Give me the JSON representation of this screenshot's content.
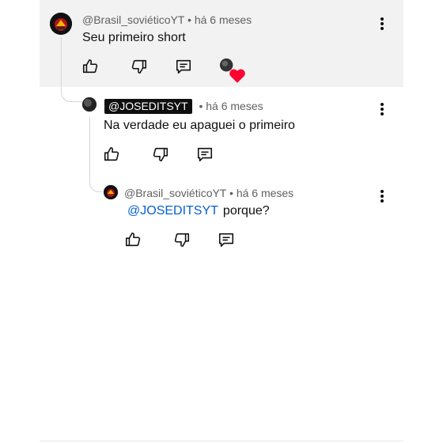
{
  "comments": [
    {
      "author": "@Brasil_soviéticoYT",
      "time": "há 6 meses",
      "text": "Seu primeiro short",
      "icons": [
        "thumb-up-icon",
        "thumb-down-icon",
        "reply-icon",
        "creator-heart-icon"
      ]
    },
    {
      "author": "@JOSEDITSYT",
      "time": "há 6 meses",
      "text": "Na verdade eu apaguei o primeiro",
      "icons": [
        "thumb-up-icon",
        "thumb-down-icon",
        "reply-icon"
      ]
    },
    {
      "author": "@Brasil_soviéticoYT",
      "time": "há 6 meses",
      "mention": "@JOSEDITSYT",
      "text": "porque?",
      "icons": [
        "thumb-up-icon",
        "thumb-down-icon",
        "reply-icon"
      ]
    }
  ],
  "separator": "•",
  "colors": {
    "highlight_bg": "#f2f2f2",
    "mention": "#065fd4",
    "meta": "#606060",
    "heart": "#ff0033"
  }
}
